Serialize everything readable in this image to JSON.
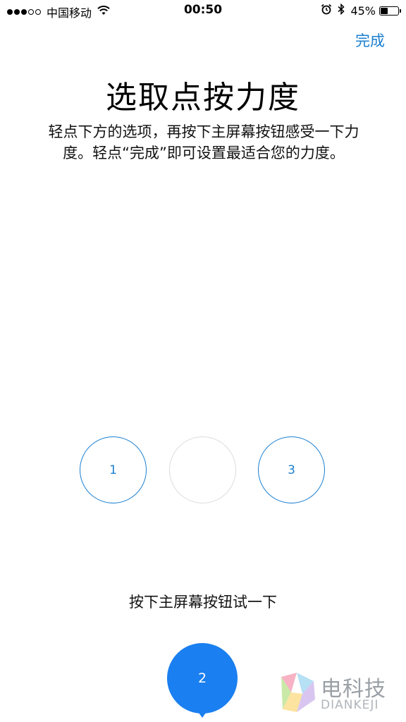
{
  "status_bar": {
    "carrier": "中国移动",
    "time": "00:50",
    "battery_percent": "45%",
    "battery_level": 0.45,
    "signal_filled": 3,
    "signal_total": 5
  },
  "nav": {
    "done_label": "完成"
  },
  "title": "选取点按力度",
  "description": "轻点下方的选项，再按下主屏幕按钮感受一下力度。轻点“完成”即可设置最适合您的力度。",
  "options": [
    {
      "label": "1"
    },
    {
      "label": ""
    },
    {
      "label": "3"
    }
  ],
  "instruction": "按下主屏幕按钮试一下",
  "selected_label": "2",
  "watermark": {
    "name": "电科技",
    "sub": "DIANKEJI"
  },
  "colors": {
    "accent": "#1a7fd1",
    "selected": "#1a7ff0"
  }
}
